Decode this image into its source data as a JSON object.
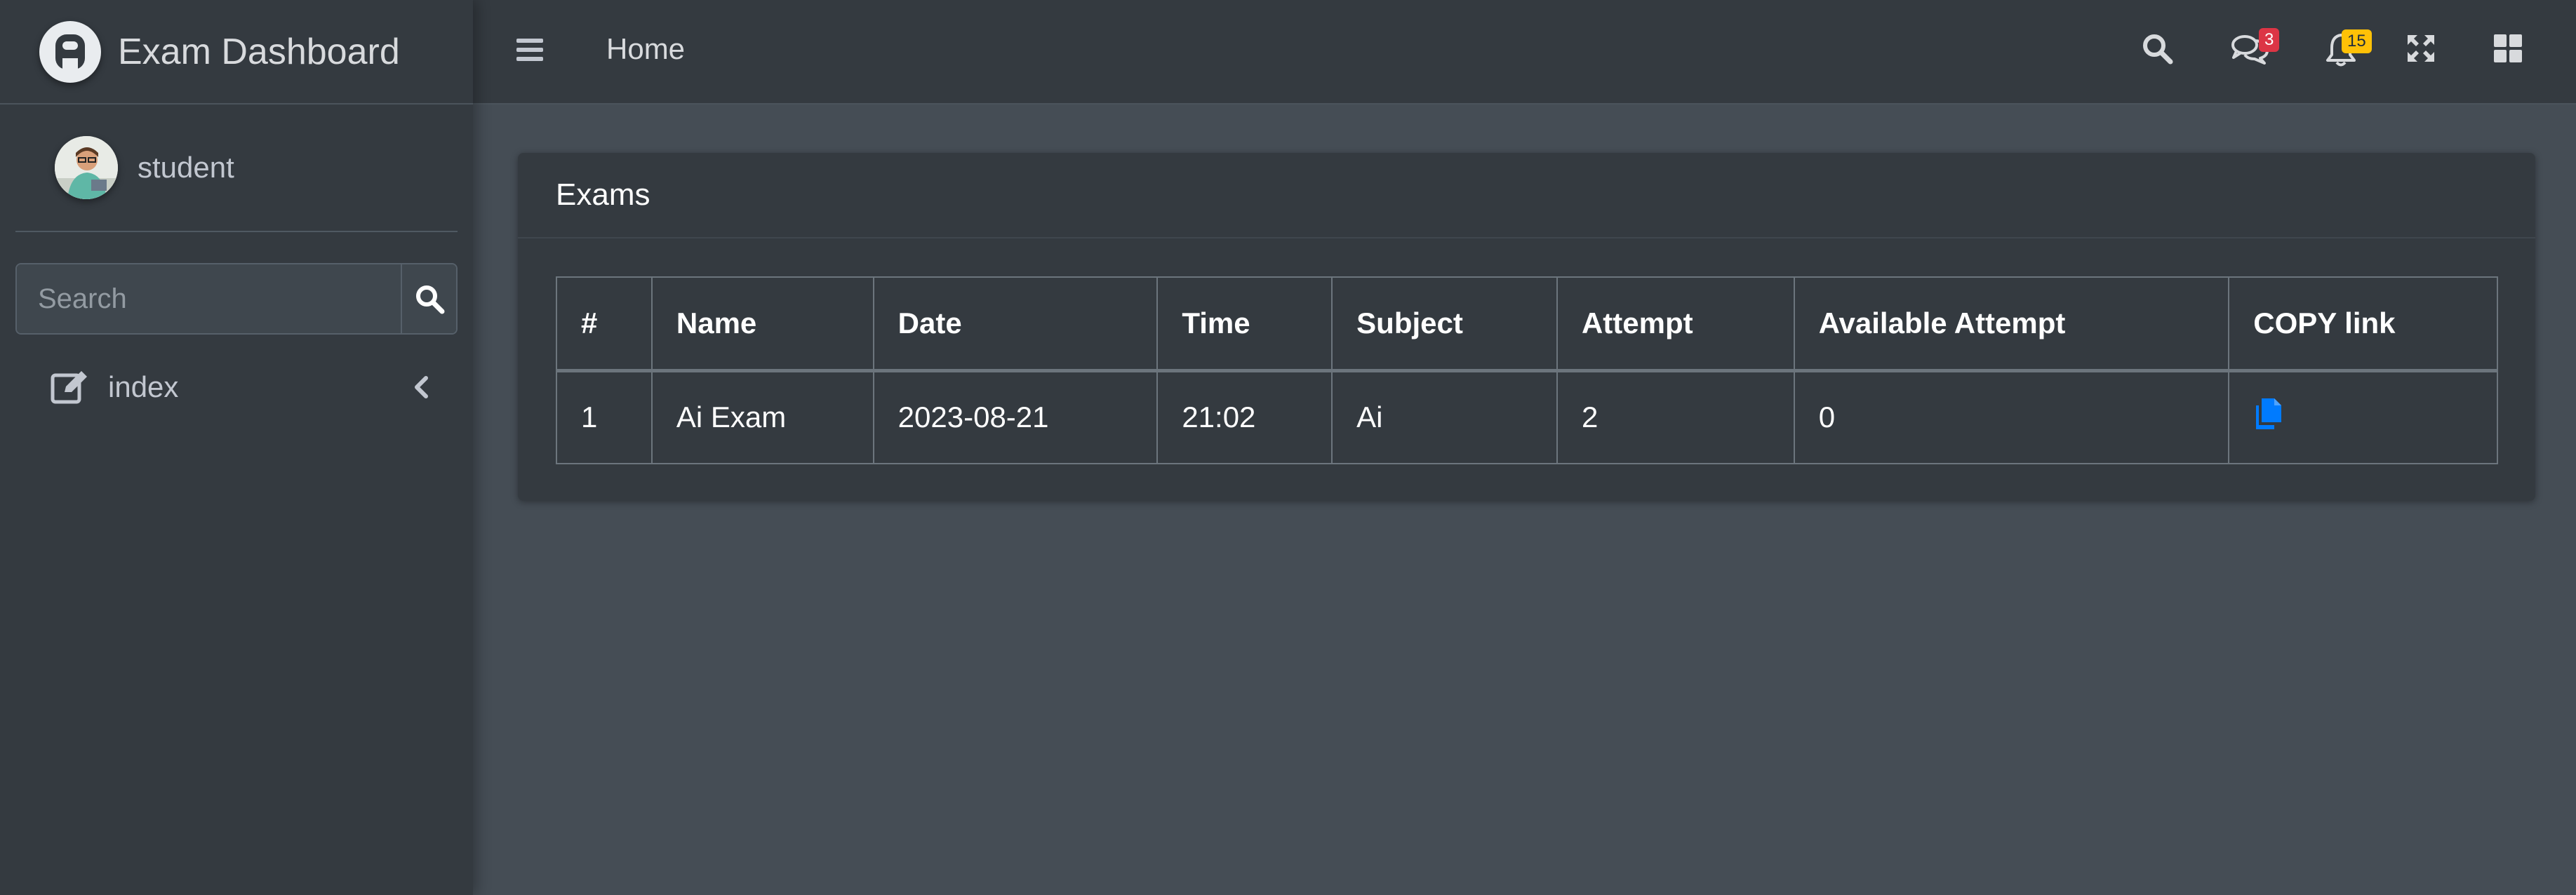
{
  "brand": {
    "title": "Exam Dashboard"
  },
  "user": {
    "name": "student"
  },
  "sidebar": {
    "search_placeholder": "Search",
    "items": [
      {
        "label": "index",
        "icon": "edit-icon"
      }
    ]
  },
  "navbar": {
    "home_label": "Home",
    "messages_badge": "3",
    "notifications_badge": "15"
  },
  "card": {
    "title": "Exams",
    "columns": [
      "#",
      "Name",
      "Date",
      "Time",
      "Subject",
      "Attempt",
      "Available Attempt",
      "COPY link"
    ],
    "rows": [
      [
        "1",
        "Ai Exam",
        "2023-08-21",
        "21:02",
        "Ai",
        "2",
        "0"
      ]
    ]
  },
  "colors": {
    "sidebar_bg": "#343a40",
    "content_bg": "#454d55",
    "badge_danger": "#dc3545",
    "badge_warning": "#ffc107",
    "link_blue": "#007bff"
  }
}
